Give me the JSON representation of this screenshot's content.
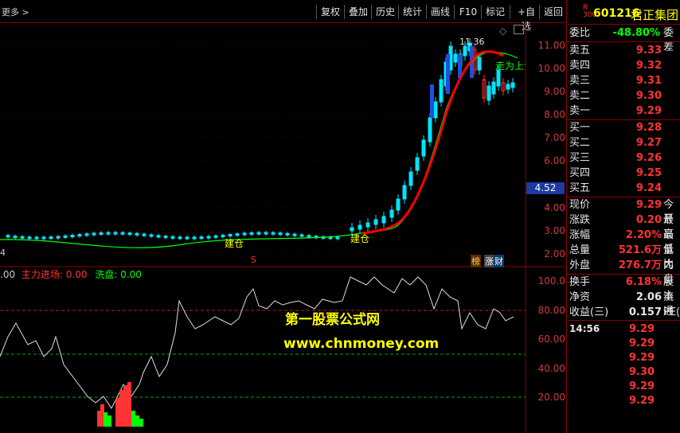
{
  "toolbar": {
    "more": "更多 >",
    "buttons": [
      "复权",
      "叠加",
      "历史",
      "统计",
      "画线",
      "F10",
      "标记",
      "+自选",
      "返回"
    ]
  },
  "stock": {
    "r_badge": "R",
    "badge_num": "300",
    "code": "601216",
    "name": "君正集团"
  },
  "quote": {
    "weibi": {
      "label": "委比",
      "value": "-48.80%",
      "extra": "委差"
    },
    "sells": [
      {
        "label": "卖五",
        "price": "9.33"
      },
      {
        "label": "卖四",
        "price": "9.32"
      },
      {
        "label": "卖三",
        "price": "9.31"
      },
      {
        "label": "卖二",
        "price": "9.30"
      },
      {
        "label": "卖一",
        "price": "9.29"
      }
    ],
    "buys": [
      {
        "label": "买一",
        "price": "9.28"
      },
      {
        "label": "买二",
        "price": "9.27"
      },
      {
        "label": "买三",
        "price": "9.26"
      },
      {
        "label": "买四",
        "price": "9.25"
      },
      {
        "label": "买五",
        "price": "9.24"
      }
    ],
    "stats": [
      {
        "label": "现价",
        "value": "9.29",
        "extra": "今开"
      },
      {
        "label": "涨跌",
        "value": "0.20",
        "extra": "最高"
      },
      {
        "label": "涨幅",
        "value": "2.20%",
        "extra": "最低"
      },
      {
        "label": "总量",
        "value": "521.6万",
        "extra": "量比"
      },
      {
        "label": "外盘",
        "value": "276.7万",
        "extra": "内盘"
      }
    ],
    "stats2": [
      {
        "label": "换手",
        "value": "6.18%",
        "extra": "股本"
      },
      {
        "label": "净资",
        "value": "2.06",
        "extra": "流通"
      },
      {
        "label": "收益(三)",
        "value": "0.157",
        "extra": "PE(动"
      }
    ],
    "tick_time": "14:56",
    "ticks": [
      "9.29",
      "9.29",
      "9.29",
      "9.30",
      "9.29",
      "9.29"
    ]
  },
  "main_chart": {
    "y_labels": [
      "11.00",
      "10.00",
      "9.00",
      "8.00",
      "7.00",
      "6.00",
      "4.00",
      "3.00",
      "2.00"
    ],
    "price_box": "4.52",
    "left_edge_label": "4",
    "high_marker": "11.36",
    "signal_labels": [
      "建仓",
      "建仓",
      "走为上计"
    ],
    "s_marker": "S",
    "tags": [
      "榜",
      "涨",
      "财"
    ]
  },
  "indicator": {
    "legend_prefix": ".00",
    "legend_main": "主力进场: 0.00",
    "legend_wash": "洗盘: 0.00",
    "y_labels": [
      "100.0",
      "80.00",
      "60.00",
      "40.00",
      "20.00"
    ]
  },
  "watermark": {
    "line1": "第一股票公式网",
    "line2": "www.chnmoney.com"
  },
  "colors": {
    "up": "#ff3333",
    "down": "#00e5ff",
    "ma": "#ff0000",
    "green": "#00ff00",
    "grid": "#8b0000",
    "yellow": "#ffff00"
  }
}
